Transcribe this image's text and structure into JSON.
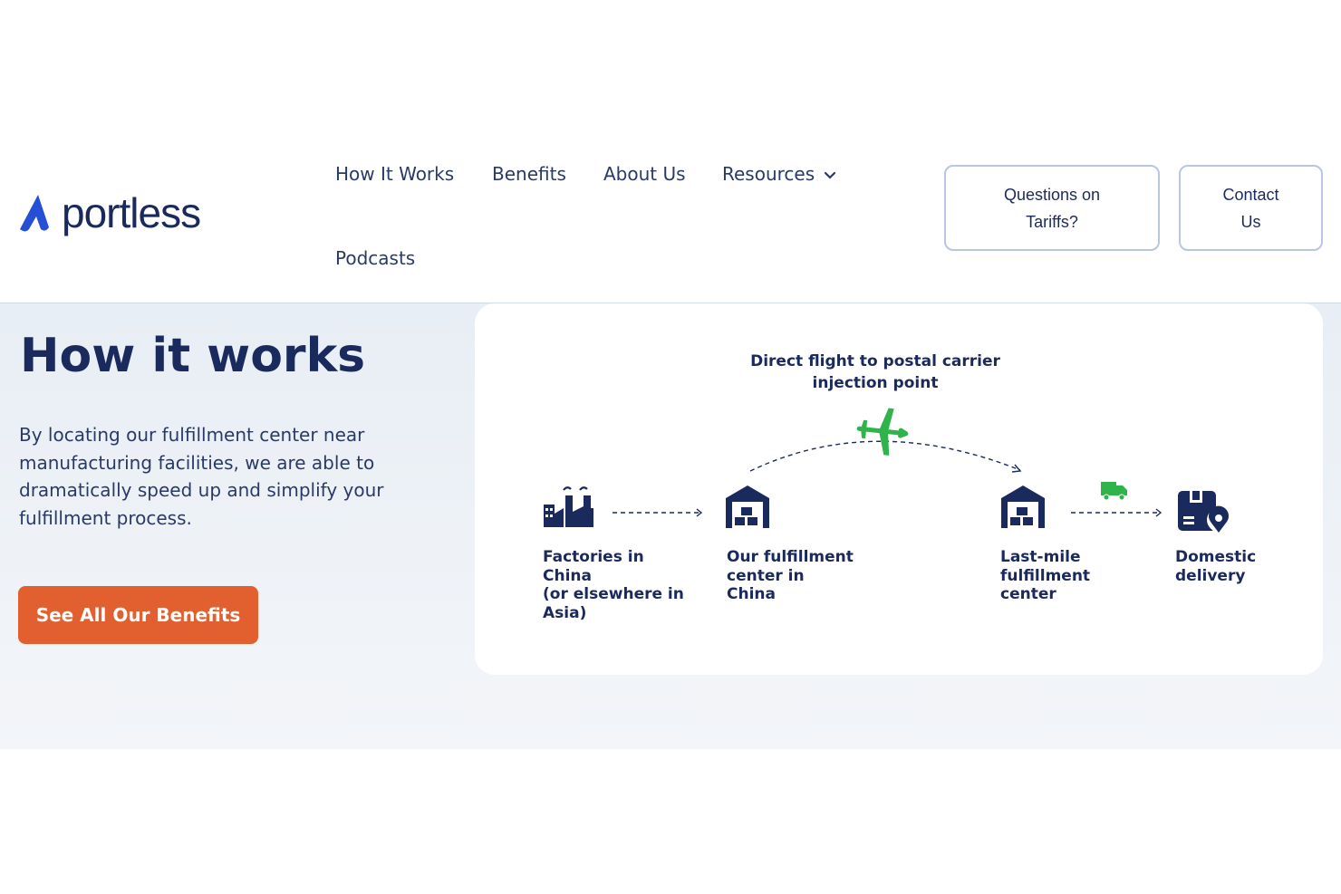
{
  "header": {
    "logo_text": "portless",
    "nav": [
      {
        "label": "How It Works"
      },
      {
        "label": "Benefits"
      },
      {
        "label": "About Us"
      },
      {
        "label": "Resources",
        "has_dropdown": true
      },
      {
        "label": "Podcasts"
      }
    ],
    "buttons": {
      "tariffs": {
        "line1": "Questions on",
        "line2": "Tariffs?"
      },
      "contact": {
        "line1": "Contact",
        "line2": "Us"
      }
    }
  },
  "hero": {
    "title": "How it works",
    "description": "By locating our fulfillment center near manufacturing facilities, we are able to dramatically speed up and simplify your fulfillment process.",
    "cta_label": "See All Our Benefits"
  },
  "diagram": {
    "flight_label_line1": "Direct flight to postal carrier",
    "flight_label_line2": "injection point",
    "steps": [
      {
        "line1": "Factories in China",
        "line2": "(or elsewhere in",
        "line3": "Asia)",
        "icon": "factory-icon"
      },
      {
        "line1": "Our fulfillment",
        "line2": "center in",
        "line3": "China",
        "icon": "warehouse-icon"
      },
      {
        "line1": "Last-mile",
        "line2": "fulfillment",
        "line3": "center",
        "icon": "warehouse-icon"
      },
      {
        "line1": "Domestic",
        "line2": "delivery",
        "icon": "package-location-icon"
      }
    ],
    "icons": {
      "plane": "airplane-icon",
      "truck": "truck-icon"
    }
  },
  "colors": {
    "brand_navy": "#1b2a5c",
    "logo_blue": "#2550d6",
    "cta_orange": "#e2602f",
    "plane_green": "#2eb44a",
    "button_border": "#b8c6e4"
  }
}
